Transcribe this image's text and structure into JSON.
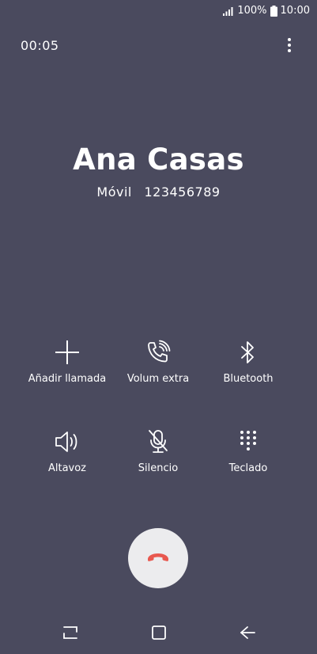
{
  "status_bar": {
    "battery": "100%",
    "time": "10:00",
    "icons": [
      "signal-icon",
      "battery-icon"
    ]
  },
  "call": {
    "timer": "00:05",
    "contact_name": "Ana Casas",
    "number_type": "Móvil",
    "number": "123456789"
  },
  "actions": {
    "add_call": {
      "label": "Añadir llamada",
      "icon": "plus-icon"
    },
    "extra_volume": {
      "label": "Volum extra",
      "icon": "phone-volume-icon"
    },
    "bluetooth": {
      "label": "Bluetooth",
      "icon": "bluetooth-icon"
    },
    "speaker": {
      "label": "Altavoz",
      "icon": "speaker-icon"
    },
    "mute": {
      "label": "Silencio",
      "icon": "mic-off-icon"
    },
    "keypad": {
      "label": "Teclado",
      "icon": "keypad-icon"
    }
  },
  "end_call": {
    "icon": "hang-up-icon",
    "color": "#e8584f"
  },
  "nav": {
    "icons": [
      "recents-icon",
      "home-icon",
      "back-icon"
    ]
  },
  "colors": {
    "background": "#4a4a5e",
    "end_button_bg": "#ececee"
  }
}
